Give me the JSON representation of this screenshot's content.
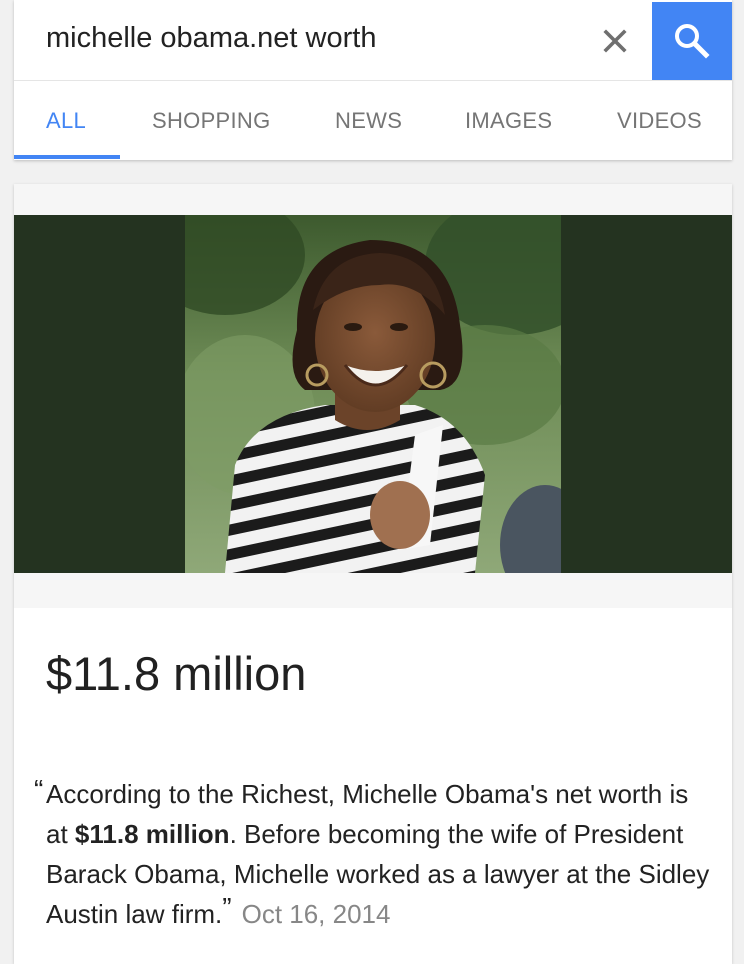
{
  "search": {
    "query": "michelle obama.net worth",
    "clear_icon": "close-icon",
    "search_icon": "search-icon",
    "accent_color": "#4285f4"
  },
  "tabs": [
    {
      "label": "ALL",
      "active": true
    },
    {
      "label": "SHOPPING",
      "active": false
    },
    {
      "label": "NEWS",
      "active": false
    },
    {
      "label": "IMAGES",
      "active": false
    },
    {
      "label": "VIDEOS",
      "active": false
    }
  ],
  "result": {
    "answer": "$11.8 million",
    "snippet": {
      "open_quote": "“",
      "text_before": "According to the Richest, Michelle Obama's net worth is at ",
      "bold": "$11.8 million",
      "text_after": ". Before becoming the wife of President Barack Obama, Michelle worked as a lawyer at the Sidley Austin law firm.",
      "close_quote": "”",
      "date": "Oct 16, 2014"
    }
  }
}
